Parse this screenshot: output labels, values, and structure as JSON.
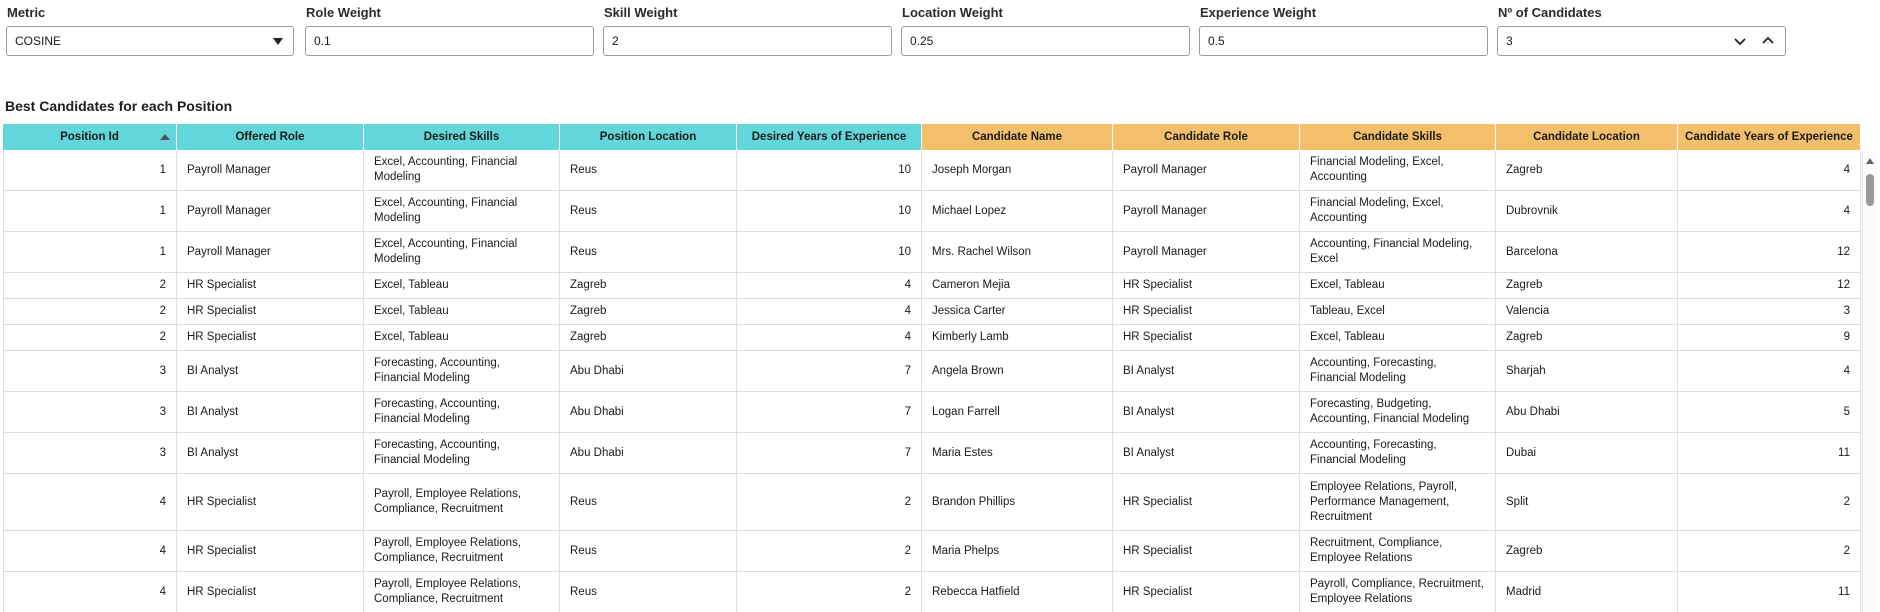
{
  "controls": {
    "metric": {
      "label": "Metric",
      "value": "COSINE"
    },
    "role_weight": {
      "label": "Role Weight",
      "value": "0.1"
    },
    "skill_weight": {
      "label": "Skill Weight",
      "value": "2"
    },
    "location_weight": {
      "label": "Location Weight",
      "value": "0.25"
    },
    "experience_weight": {
      "label": "Experience Weight",
      "value": "0.5"
    },
    "num_candidates": {
      "label": "Nº of Candidates",
      "value": "3"
    }
  },
  "section_title": "Best Candidates for each Position",
  "table": {
    "headers": [
      "Position Id",
      "Offered Role",
      "Desired Skills",
      "Position Location",
      "Desired Years of Experience",
      "Candidate Name",
      "Candidate Role",
      "Candidate Skills",
      "Candidate Location",
      "Candidate Years of Experience"
    ],
    "sorted_column": "Position Id",
    "colors": {
      "position": "#62d6da",
      "candidate": "#f4bf6a"
    },
    "rows": [
      [
        "1",
        "Payroll Manager",
        "Excel, Accounting, Financial Modeling",
        "Reus",
        "10",
        "Joseph Morgan",
        "Payroll Manager",
        "Financial Modeling, Excel, Accounting",
        "Zagreb",
        "4"
      ],
      [
        "1",
        "Payroll Manager",
        "Excel, Accounting, Financial Modeling",
        "Reus",
        "10",
        "Michael Lopez",
        "Payroll Manager",
        "Financial Modeling, Excel, Accounting",
        "Dubrovnik",
        "4"
      ],
      [
        "1",
        "Payroll Manager",
        "Excel, Accounting, Financial Modeling",
        "Reus",
        "10",
        "Mrs. Rachel Wilson",
        "Payroll Manager",
        "Accounting, Financial Modeling, Excel",
        "Barcelona",
        "12"
      ],
      [
        "2",
        "HR Specialist",
        "Excel, Tableau",
        "Zagreb",
        "4",
        "Cameron Mejia",
        "HR Specialist",
        "Excel, Tableau",
        "Zagreb",
        "12"
      ],
      [
        "2",
        "HR Specialist",
        "Excel, Tableau",
        "Zagreb",
        "4",
        "Jessica Carter",
        "HR Specialist",
        "Tableau, Excel",
        "Valencia",
        "3"
      ],
      [
        "2",
        "HR Specialist",
        "Excel, Tableau",
        "Zagreb",
        "4",
        "Kimberly Lamb",
        "HR Specialist",
        "Excel, Tableau",
        "Zagreb",
        "9"
      ],
      [
        "3",
        "BI Analyst",
        "Forecasting, Accounting, Financial Modeling",
        "Abu Dhabi",
        "7",
        "Angela Brown",
        "BI Analyst",
        "Accounting, Forecasting, Financial Modeling",
        "Sharjah",
        "4"
      ],
      [
        "3",
        "BI Analyst",
        "Forecasting, Accounting, Financial Modeling",
        "Abu Dhabi",
        "7",
        "Logan Farrell",
        "BI Analyst",
        "Forecasting, Budgeting, Accounting, Financial Modeling",
        "Abu Dhabi",
        "5"
      ],
      [
        "3",
        "BI Analyst",
        "Forecasting, Accounting, Financial Modeling",
        "Abu Dhabi",
        "7",
        "Maria Estes",
        "BI Analyst",
        "Accounting, Forecasting, Financial Modeling",
        "Dubai",
        "11"
      ],
      [
        "4",
        "HR Specialist",
        "Payroll, Employee Relations, Compliance, Recruitment",
        "Reus",
        "2",
        "Brandon Phillips",
        "HR Specialist",
        "Employee Relations, Payroll, Performance Management, Recruitment",
        "Split",
        "2"
      ],
      [
        "4",
        "HR Specialist",
        "Payroll, Employee Relations, Compliance, Recruitment",
        "Reus",
        "2",
        "Maria Phelps",
        "HR Specialist",
        "Recruitment, Compliance, Employee Relations",
        "Zagreb",
        "2"
      ],
      [
        "4",
        "HR Specialist",
        "Payroll, Employee Relations, Compliance, Recruitment",
        "Reus",
        "2",
        "Rebecca Hatfield",
        "HR Specialist",
        "Payroll, Compliance, Recruitment, Employee Relations",
        "Madrid",
        "11"
      ]
    ]
  },
  "icons": {
    "dropdown": "chevron-down-icon",
    "decrement": "chevron-down-icon",
    "increment": "chevron-up-icon",
    "sort": "sort-ascending-icon"
  }
}
